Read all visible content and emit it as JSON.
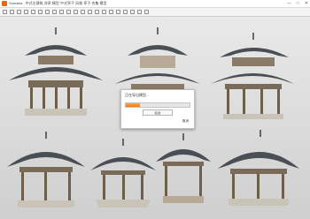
{
  "window": {
    "title": "Sumatra - 中式古建筑 凉亭 模型 中式亭子 风格 亭子 合集 模型",
    "controls": [
      "—",
      "□",
      "✕"
    ]
  },
  "toolbar": {
    "icons": [
      "file-icon",
      "save-icon",
      "undo-icon",
      "redo-icon",
      "cut-icon",
      "copy-icon",
      "paste-icon",
      "move-icon",
      "rotate-icon",
      "scale-icon",
      "select-icon",
      "orbit-icon",
      "pan-icon",
      "zoom-icon",
      "fit-icon",
      "grid-icon",
      "render-icon",
      "camera-icon",
      "light-icon",
      "material-icon",
      "settings-icon"
    ]
  },
  "dialog": {
    "title": "正在导出模型...",
    "progress": 0.22,
    "button_label": "后台",
    "cancel_label": "取消"
  },
  "colors": {
    "roof": "#4a4e55",
    "wood": "#7a6a58",
    "stone": "#c9c3b8",
    "accent": "#e8791f"
  }
}
